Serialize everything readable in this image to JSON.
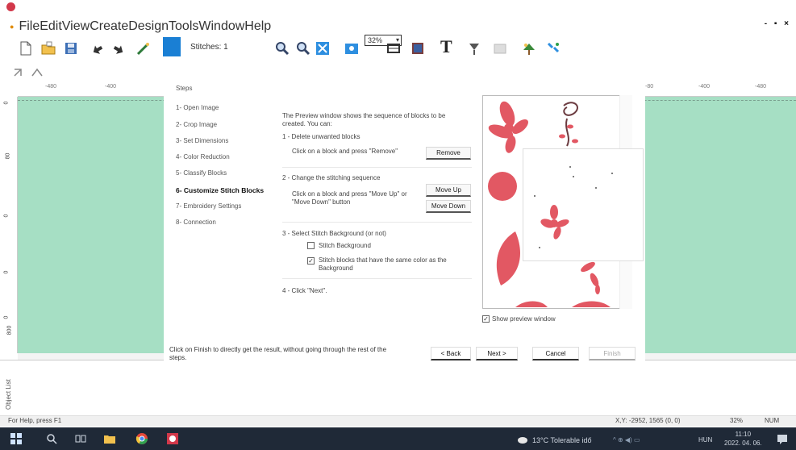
{
  "menu": {
    "items": [
      "File",
      "Edit",
      "View",
      "Create",
      "Design",
      "Tools",
      "Window",
      "Help"
    ],
    "window_controls": "- ▪ ×"
  },
  "toolbar": {
    "stitches_label": "Stitches: 1",
    "zoom_value": "32%",
    "text_tool_label": "T"
  },
  "ruler": {
    "top_ticks": [
      "-480",
      "-400",
      "-80",
      "-400",
      "-480"
    ],
    "left_ticks": [
      "0",
      "80",
      "0",
      "0",
      "0",
      "800"
    ]
  },
  "dialog": {
    "steps_title": "Steps",
    "steps": [
      "1- Open Image",
      "2- Crop Image",
      "3- Set Dimensions",
      "4- Color Reduction",
      "5- Classify Blocks",
      "6- Customize Stitch Blocks",
      "7- Embroidery Settings",
      "8- Connection"
    ],
    "active_step_index": 5,
    "intro": "The Preview window shows the sequence of blocks to be created. You can:",
    "section1_title": "1 - Delete unwanted blocks",
    "section1_desc": "Click on a block and press \"Remove\"",
    "remove_button": "Remove",
    "section2_title": "2 - Change the stitching sequence",
    "section2_desc": "Click on a block and press \"Move Up\" or \"Move Down\" button",
    "move_up_button": "Move Up",
    "move_down_button": "Move Down",
    "section3_title": "3 - Select Stitch Background (or not)",
    "stitch_background_label": "Stitch Background",
    "stitch_background_checked": false,
    "same_color_label": "Stitch blocks that have the same color as the Background",
    "same_color_checked": true,
    "section4_title": "4 - Click \"Next\".",
    "show_preview_label": "Show preview window",
    "show_preview_checked": true,
    "finish_note": "Click on Finish to directly get the result, without going through the rest of the steps.",
    "back_button": "< Back",
    "next_button": "Next >",
    "cancel_button": "Cancel",
    "finish_button": "Finish"
  },
  "status": {
    "help": "For Help, press F1",
    "coords": "X,Y: -2952, 1565 (0, 0)",
    "zoom": "32%",
    "num": "NUM"
  },
  "taskbar": {
    "weather": "13°C Tolerable idő",
    "lang": "HUN",
    "time": "11:10",
    "date": "2022. 04. 06."
  },
  "colors": {
    "canvas": "#a6dfc4",
    "preview_shape": "#e25863",
    "taskbar": "#1f2937",
    "toolbar_accent": "#1a7fd4"
  }
}
